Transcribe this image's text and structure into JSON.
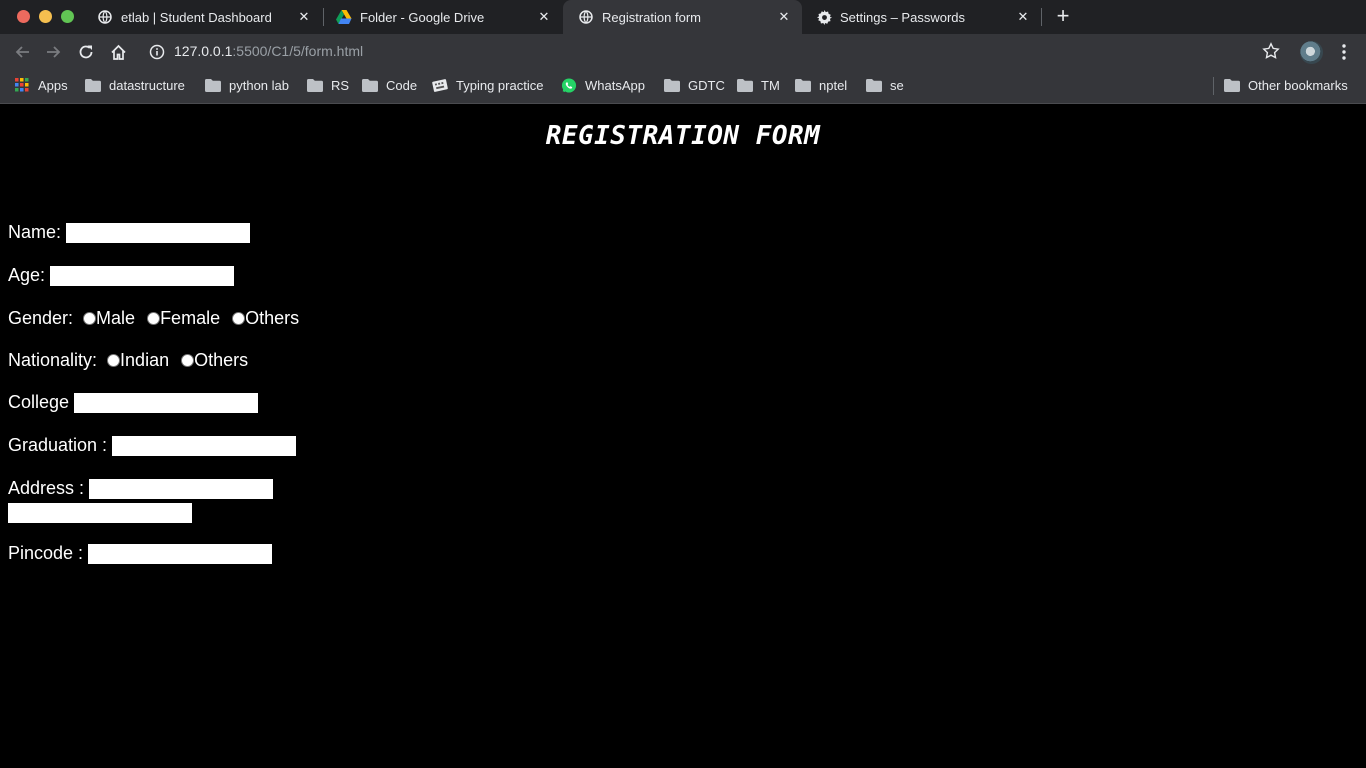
{
  "browser": {
    "tabs": [
      {
        "label": "etlab | Student Dashboard",
        "icon": "globe-icon",
        "active": false
      },
      {
        "label": "Folder - Google Drive",
        "icon": "google-drive-icon",
        "active": false
      },
      {
        "label": "Registration form",
        "icon": "globe-icon",
        "active": true
      },
      {
        "label": "Settings – Passwords",
        "icon": "gear-icon",
        "active": false
      }
    ],
    "new_tab_label": "+",
    "url_host": "127.0.0.1",
    "url_path": ":5500/C1/5/form.html",
    "bookmarks": [
      {
        "label": "Apps",
        "icon": "apps-grid-icon"
      },
      {
        "label": "datastructure",
        "icon": "folder-icon"
      },
      {
        "label": "python lab",
        "icon": "folder-icon"
      },
      {
        "label": "RS",
        "icon": "folder-icon"
      },
      {
        "label": "Code",
        "icon": "folder-icon"
      },
      {
        "label": "Typing practice",
        "icon": "keyboard-icon"
      },
      {
        "label": "WhatsApp",
        "icon": "whatsapp-icon"
      },
      {
        "label": "GDTC",
        "icon": "folder-icon"
      },
      {
        "label": "TM",
        "icon": "folder-icon"
      },
      {
        "label": "nptel",
        "icon": "folder-icon"
      },
      {
        "label": "se",
        "icon": "folder-icon"
      }
    ],
    "other_bookmarks": "Other bookmarks"
  },
  "form": {
    "title": "REGISTRATION FORM",
    "name_label": "Name:",
    "age_label": "Age:",
    "gender_label": "Gender:",
    "gender_options": [
      "Male",
      "Female",
      "Others"
    ],
    "nationality_label": "Nationality:",
    "nationality_options": [
      "Indian",
      "Others"
    ],
    "college_label": "College",
    "graduation_label": "Graduation :",
    "address_label": "Address :",
    "pincode_label": "Pincode :"
  }
}
